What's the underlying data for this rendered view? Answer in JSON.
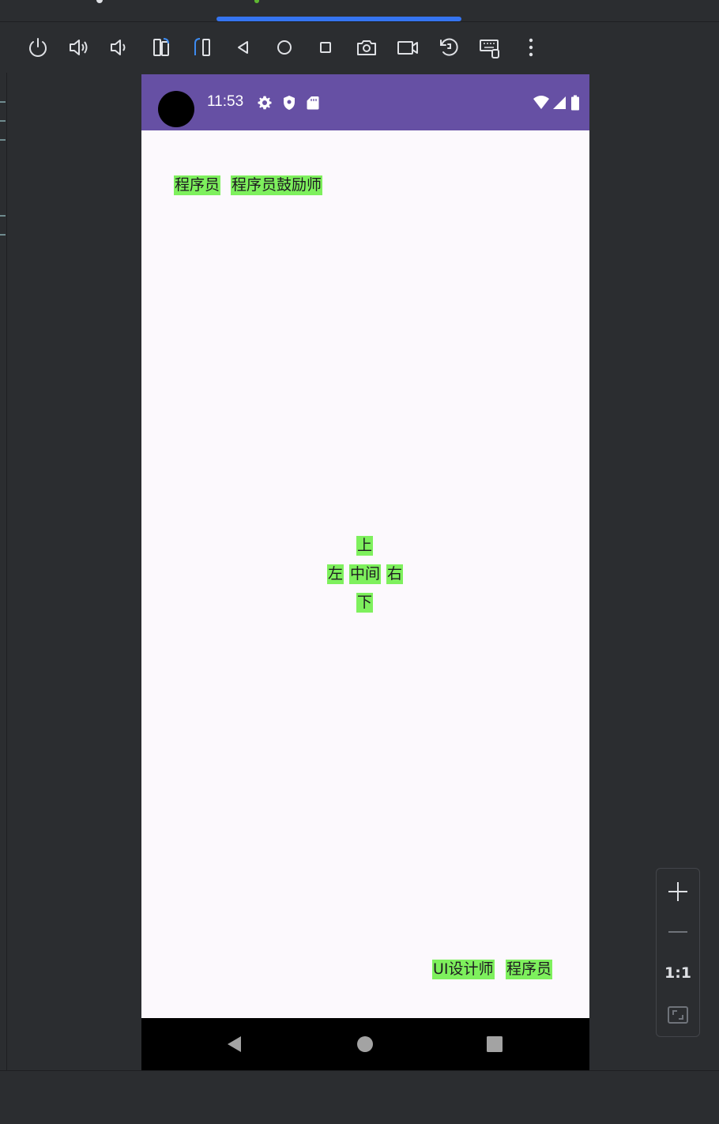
{
  "colors": {
    "ide_background": "#2b2d30",
    "accent": "#3574f0",
    "status_bar": "#6650a4",
    "app_background": "#fcf9fd",
    "chip_background": "#7ef05d",
    "nav_bar": "#000000"
  },
  "toolbar": {
    "buttons": [
      {
        "icon": "power-icon"
      },
      {
        "icon": "volume-up-icon"
      },
      {
        "icon": "volume-down-icon"
      },
      {
        "icon": "rotate-left-icon"
      },
      {
        "icon": "rotate-right-icon"
      },
      {
        "icon": "back-icon"
      },
      {
        "icon": "home-icon"
      },
      {
        "icon": "overview-icon"
      },
      {
        "icon": "screenshot-icon"
      },
      {
        "icon": "screen-record-icon"
      },
      {
        "icon": "snapshot-restore-icon"
      },
      {
        "icon": "keyboard-icon"
      },
      {
        "icon": "more-vertical-icon"
      }
    ]
  },
  "device": {
    "status_bar": {
      "time": "11:53",
      "left_icons": [
        "settings-icon",
        "shield-icon",
        "sd-card-icon"
      ],
      "right_icons": [
        "wifi-icon",
        "signal-icon",
        "battery-icon"
      ]
    },
    "top_left_labels": [
      "程序员",
      "程序员鼓励师"
    ],
    "cross": {
      "top": "上",
      "left": "左",
      "center": "中间",
      "right": "右",
      "bottom": "下"
    },
    "bottom_right_labels": [
      "UI设计师",
      "程序员"
    ],
    "nav_bar": {
      "buttons": [
        "back-triangle-icon",
        "home-circle-icon",
        "recents-square-icon"
      ]
    }
  },
  "zoom_panel": {
    "zoom_in_icon": "plus-icon",
    "zoom_out_icon": "minus-icon",
    "actual_size_label": "1:1",
    "fit_icon": "fit-screen-icon"
  }
}
